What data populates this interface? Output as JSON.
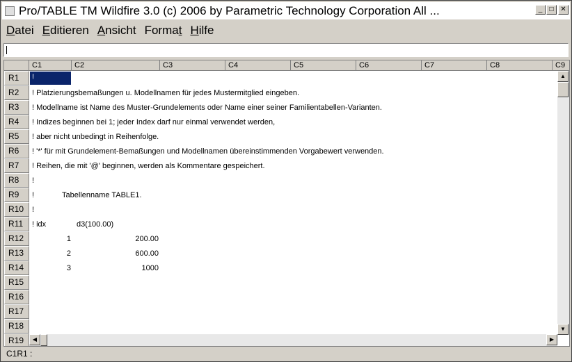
{
  "window": {
    "title": "Pro/TABLE  TM  Wildfire 3.0  (c) 2006 by Parametric Technology Corporation  All ..."
  },
  "menu": [
    {
      "label": "Datei",
      "hotkey": "D"
    },
    {
      "label": "Editieren",
      "hotkey": "E"
    },
    {
      "label": "Ansicht",
      "hotkey": "A"
    },
    {
      "label": "Format",
      "hotkey": "t"
    },
    {
      "label": "Hilfe",
      "hotkey": "H"
    }
  ],
  "formula_bar": {
    "value": ""
  },
  "columns": [
    "C1",
    "C2",
    "C3",
    "C4",
    "C5",
    "C6",
    "C7",
    "C8",
    "C9"
  ],
  "rows": [
    "R1",
    "R2",
    "R3",
    "R4",
    "R5",
    "R6",
    "R7",
    "R8",
    "R9",
    "R10",
    "R11",
    "R12",
    "R13",
    "R14",
    "R15",
    "R16",
    "R17",
    "R18",
    "R19"
  ],
  "cells": {
    "r1": "!",
    "r2": "!  Platzierungsbemaßungen u. Modellnamen für jedes Mustermitglied eingeben.",
    "r3": "!  Modellname ist Name des Muster-Grundelements oder Name einer seiner Familientabellen-Varianten.",
    "r4": "!  Indizes beginnen bei 1; jeder Index darf nur einmal verwendet werden,",
    "r5": "!  aber nicht unbedingt in Reihenfolge.",
    "r6": "!  '*' für mit Grundelement-Bemaßungen und Modellnamen übereinstimmenden Vorgabewert verwenden.",
    "r7": "!  Reihen, die mit '@' beginnen, werden als Kommentare gespeichert.",
    "r8": "!",
    "r9a": "!",
    "r9b": "Tabellenname TABLE1.",
    "r10": "!",
    "r11a": "! idx",
    "r11b": "d3(100.00)",
    "data": [
      {
        "idx": "1",
        "val": "200.00"
      },
      {
        "idx": "2",
        "val": "600.00"
      },
      {
        "idx": "3",
        "val": "1000"
      }
    ]
  },
  "status": "C1R1 :"
}
